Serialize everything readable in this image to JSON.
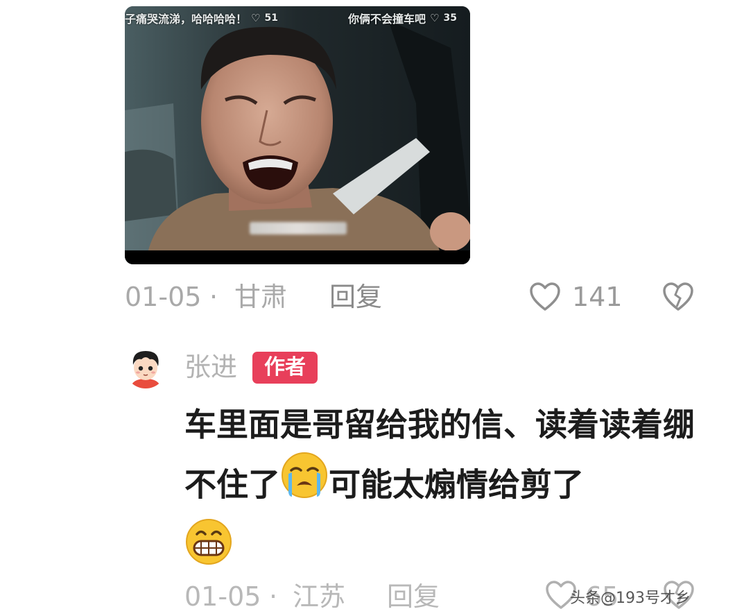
{
  "image_comment": {
    "danmu": [
      {
        "text": "子痛哭流涕，哈哈哈哈！",
        "likes": "51"
      },
      {
        "text": "你俩不会撞车吧",
        "likes": "35"
      }
    ],
    "heart_glyph": "♡"
  },
  "first_comment_meta": {
    "date": "01-05",
    "separator": "·",
    "location": "甘肃",
    "reply_label": "回复",
    "like_count": "141"
  },
  "author_comment": {
    "name": "张进",
    "badge": "作者",
    "text_part1": "车里面是哥留给我的信、读着读着绷不住了",
    "text_part2": "可能太煽情给剪了",
    "emoji_1": "loudly-crying-face",
    "emoji_2": "grinning-face-with-big-eyes"
  },
  "second_comment_meta": {
    "date": "01-05",
    "separator": "·",
    "location": "江苏",
    "reply_label": "回复",
    "like_count": "65"
  },
  "watermark": "头条@193号才乡"
}
